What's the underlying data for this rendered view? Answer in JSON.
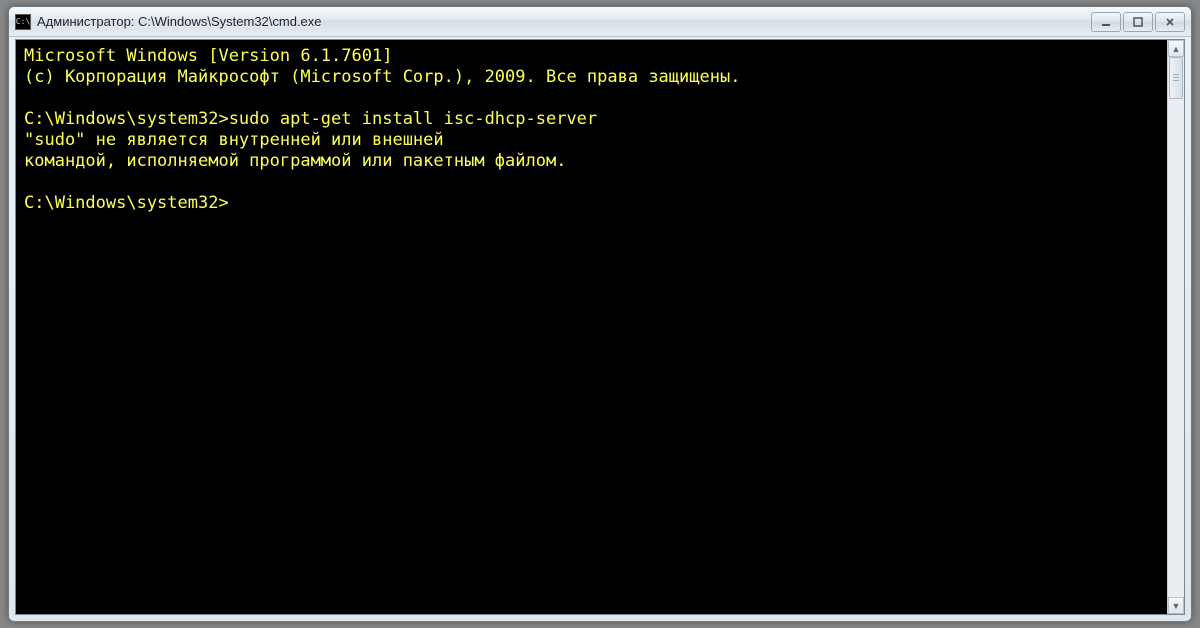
{
  "window": {
    "title": "Администратор: C:\\Windows\\System32\\cmd.exe",
    "icon_label": "C:\\"
  },
  "controls": {
    "minimize": "minimize",
    "maximize": "maximize",
    "close": "close"
  },
  "terminal": {
    "lines": [
      "Microsoft Windows [Version 6.1.7601]",
      "(c) Корпорация Майкрософт (Microsoft Corp.), 2009. Все права защищены.",
      "",
      "C:\\Windows\\system32>sudo apt-get install isc-dhcp-server",
      "\"sudo\" не является внутренней или внешней",
      "командой, исполняемой программой или пакетным файлом.",
      "",
      "C:\\Windows\\system32>"
    ]
  },
  "scrollbar": {
    "up": "▲",
    "down": "▼"
  }
}
